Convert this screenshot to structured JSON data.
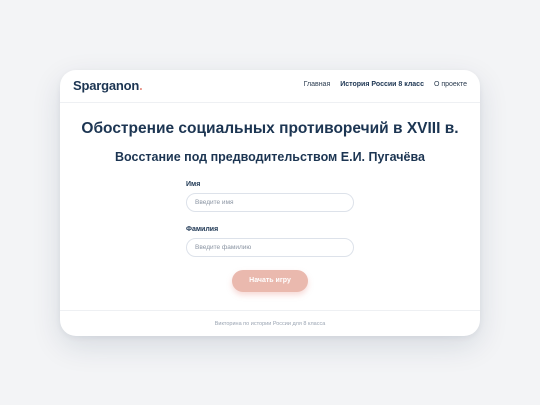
{
  "header": {
    "logo": "Sparganon",
    "logo_dot": ".",
    "nav": [
      {
        "label": "Главная",
        "active": false
      },
      {
        "label": "История России 8 класс",
        "active": true
      },
      {
        "label": "О проекте",
        "active": false
      }
    ]
  },
  "main": {
    "title": "Обострение социальных противоречий в XVIII в.",
    "subtitle": "Восстание под предводительством Е.И. Пугачёва",
    "form": {
      "first_name_label": "Имя",
      "first_name_placeholder": "Введите имя",
      "first_name_value": "",
      "last_name_label": "Фамилия",
      "last_name_placeholder": "Введите фамилию",
      "last_name_value": "",
      "submit_label": "Начать игру"
    }
  },
  "footer": {
    "text": "Викторина по истории России для 8 класса"
  },
  "colors": {
    "primary_text": "#1c3552",
    "accent": "#e9968b",
    "button_bg": "#eab9ae",
    "background": "#f3f4f6"
  }
}
